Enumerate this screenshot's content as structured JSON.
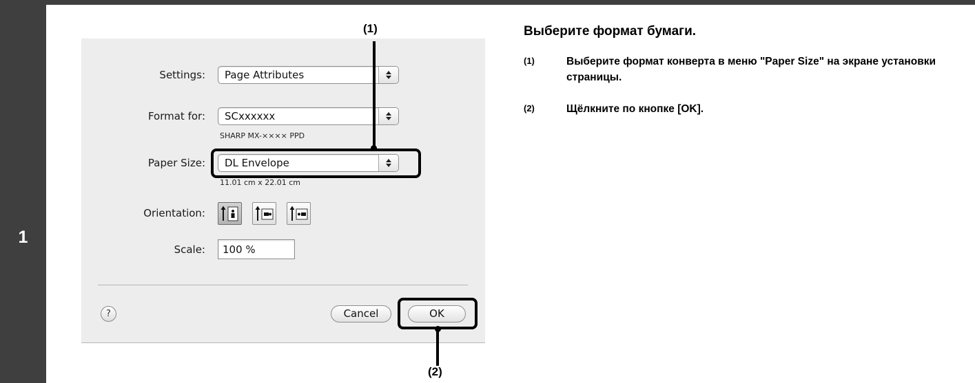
{
  "step": {
    "number": "1"
  },
  "dialog": {
    "settings": {
      "label": "Settings:",
      "value": "Page Attributes"
    },
    "format_for": {
      "label": "Format for:",
      "value": "SCxxxxxx",
      "sub": "SHARP MX-×××× PPD"
    },
    "paper_size": {
      "label": "Paper Size:",
      "value": "DL Envelope",
      "sub": "11.01 cm x 22.01 cm"
    },
    "orientation": {
      "label": "Orientation:",
      "options": [
        "portrait",
        "landscape",
        "landscape-reversed"
      ],
      "selected": "portrait"
    },
    "scale": {
      "label": "Scale:",
      "value": "100 %"
    },
    "help_label": "?",
    "cancel_label": "Cancel",
    "ok_label": "OK"
  },
  "callouts": {
    "c1": "(1)",
    "c2": "(2)"
  },
  "instructions": {
    "heading": "Выберите формат бумаги.",
    "items": [
      {
        "num": "(1)",
        "text": "Выберите формат конверта в меню \"Paper Size\" на экране установки страницы."
      },
      {
        "num": "(2)",
        "text": "Щёлкните по кнопке [OK]."
      }
    ]
  },
  "colors": {
    "sidebar": "#3f3f3f",
    "dialog_bg": "#ededed"
  }
}
